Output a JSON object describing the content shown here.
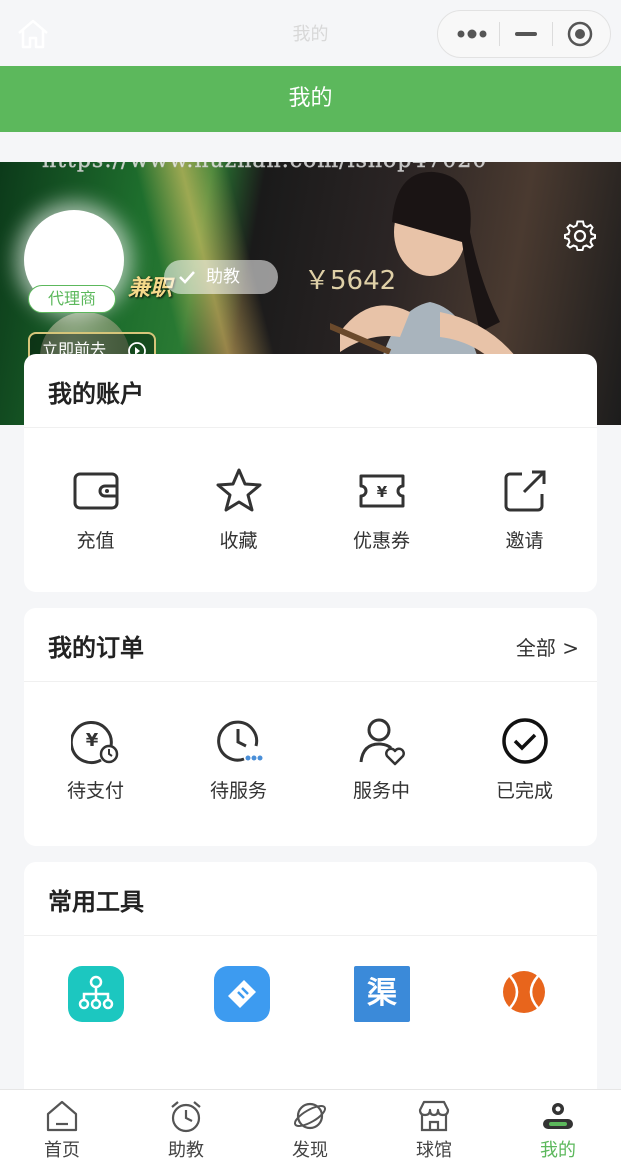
{
  "system_bar": {
    "title": "我的"
  },
  "header": {
    "title": "我的"
  },
  "banner": {
    "watermark": "https://www.huzhan.com/ishop47020",
    "agent_tag": "代理商",
    "part_time": "兼职",
    "role": "助教",
    "balance": "￥5642",
    "goto_label": "立即前去"
  },
  "account": {
    "title": "我的账户",
    "items": [
      {
        "label": "充值",
        "icon": "wallet-icon"
      },
      {
        "label": "收藏",
        "icon": "star-icon"
      },
      {
        "label": "优惠券",
        "icon": "coupon-icon"
      },
      {
        "label": "邀请",
        "icon": "share-icon"
      }
    ]
  },
  "orders": {
    "title": "我的订单",
    "more": "全部 >",
    "items": [
      {
        "label": "待支付",
        "icon": "pending-payment-icon"
      },
      {
        "label": "待服务",
        "icon": "clock-icon"
      },
      {
        "label": "服务中",
        "icon": "user-heart-icon"
      },
      {
        "label": "已完成",
        "icon": "check-circle-icon"
      }
    ]
  },
  "tools": {
    "title": "常用工具",
    "items": [
      {
        "icon": "org-tree-icon",
        "color": "#1cc7c0"
      },
      {
        "icon": "ticket-icon",
        "color": "#3d9bf0"
      },
      {
        "icon": "channel-icon",
        "text": "渠",
        "color": "#3b8ad9"
      },
      {
        "icon": "ball-icon",
        "color": "#e8651c"
      }
    ]
  },
  "tabbar": {
    "items": [
      {
        "label": "首页",
        "icon": "home-icon"
      },
      {
        "label": "助教",
        "icon": "alarm-clock-icon"
      },
      {
        "label": "发现",
        "icon": "planet-icon"
      },
      {
        "label": "球馆",
        "icon": "store-icon"
      },
      {
        "label": "我的",
        "icon": "profile-icon",
        "active": true
      }
    ],
    "active_color": "#5cb85c"
  }
}
